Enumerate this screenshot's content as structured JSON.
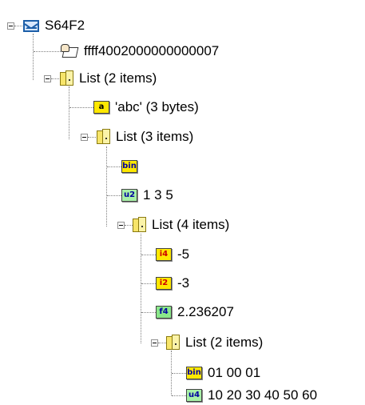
{
  "tree": {
    "root": {
      "label": "S64F2"
    },
    "system_bytes": {
      "label": "ffff4002000000000007"
    },
    "list1": {
      "label": "List (2 items)"
    },
    "a_item": {
      "badge": "a",
      "label": "'abc' (3 bytes)",
      "badge_bg": "#ffe800",
      "badge_fg": "#000000"
    },
    "list2": {
      "label": "List (3 items)"
    },
    "bin_empty": {
      "badge": "bin",
      "label": "",
      "badge_bg": "#ffe800",
      "badge_fg": "#0000a0"
    },
    "u2_item": {
      "badge": "u2",
      "label": "1 3 5",
      "badge_bg": "#a8f0a8",
      "badge_fg": "#0000a0"
    },
    "list3": {
      "label": "List (4 items)"
    },
    "i4_item": {
      "badge": "i4",
      "label": "-5",
      "badge_bg": "#ffe800",
      "badge_fg": "#cc0000"
    },
    "i2_item": {
      "badge": "i2",
      "label": "-3",
      "badge_bg": "#ffe800",
      "badge_fg": "#cc0000"
    },
    "f4_item": {
      "badge": "f4",
      "label": "2.236207",
      "badge_bg": "#8ae88a",
      "badge_fg": "#0000a0"
    },
    "list4": {
      "label": "List (2 items)"
    },
    "bin_item": {
      "badge": "bin",
      "label": "01 00 01",
      "badge_bg": "#ffe800",
      "badge_fg": "#0000a0"
    },
    "u4_item": {
      "badge": "u4",
      "label": "10 20 30 40 50 60",
      "badge_bg": "#a8f0a8",
      "badge_fg": "#0000a0"
    }
  },
  "icons": {
    "message": "envelope-icon",
    "system_bytes": "system-bytes-icon",
    "list": "list-folder-icon",
    "expander": "collapse-minus-icon"
  }
}
